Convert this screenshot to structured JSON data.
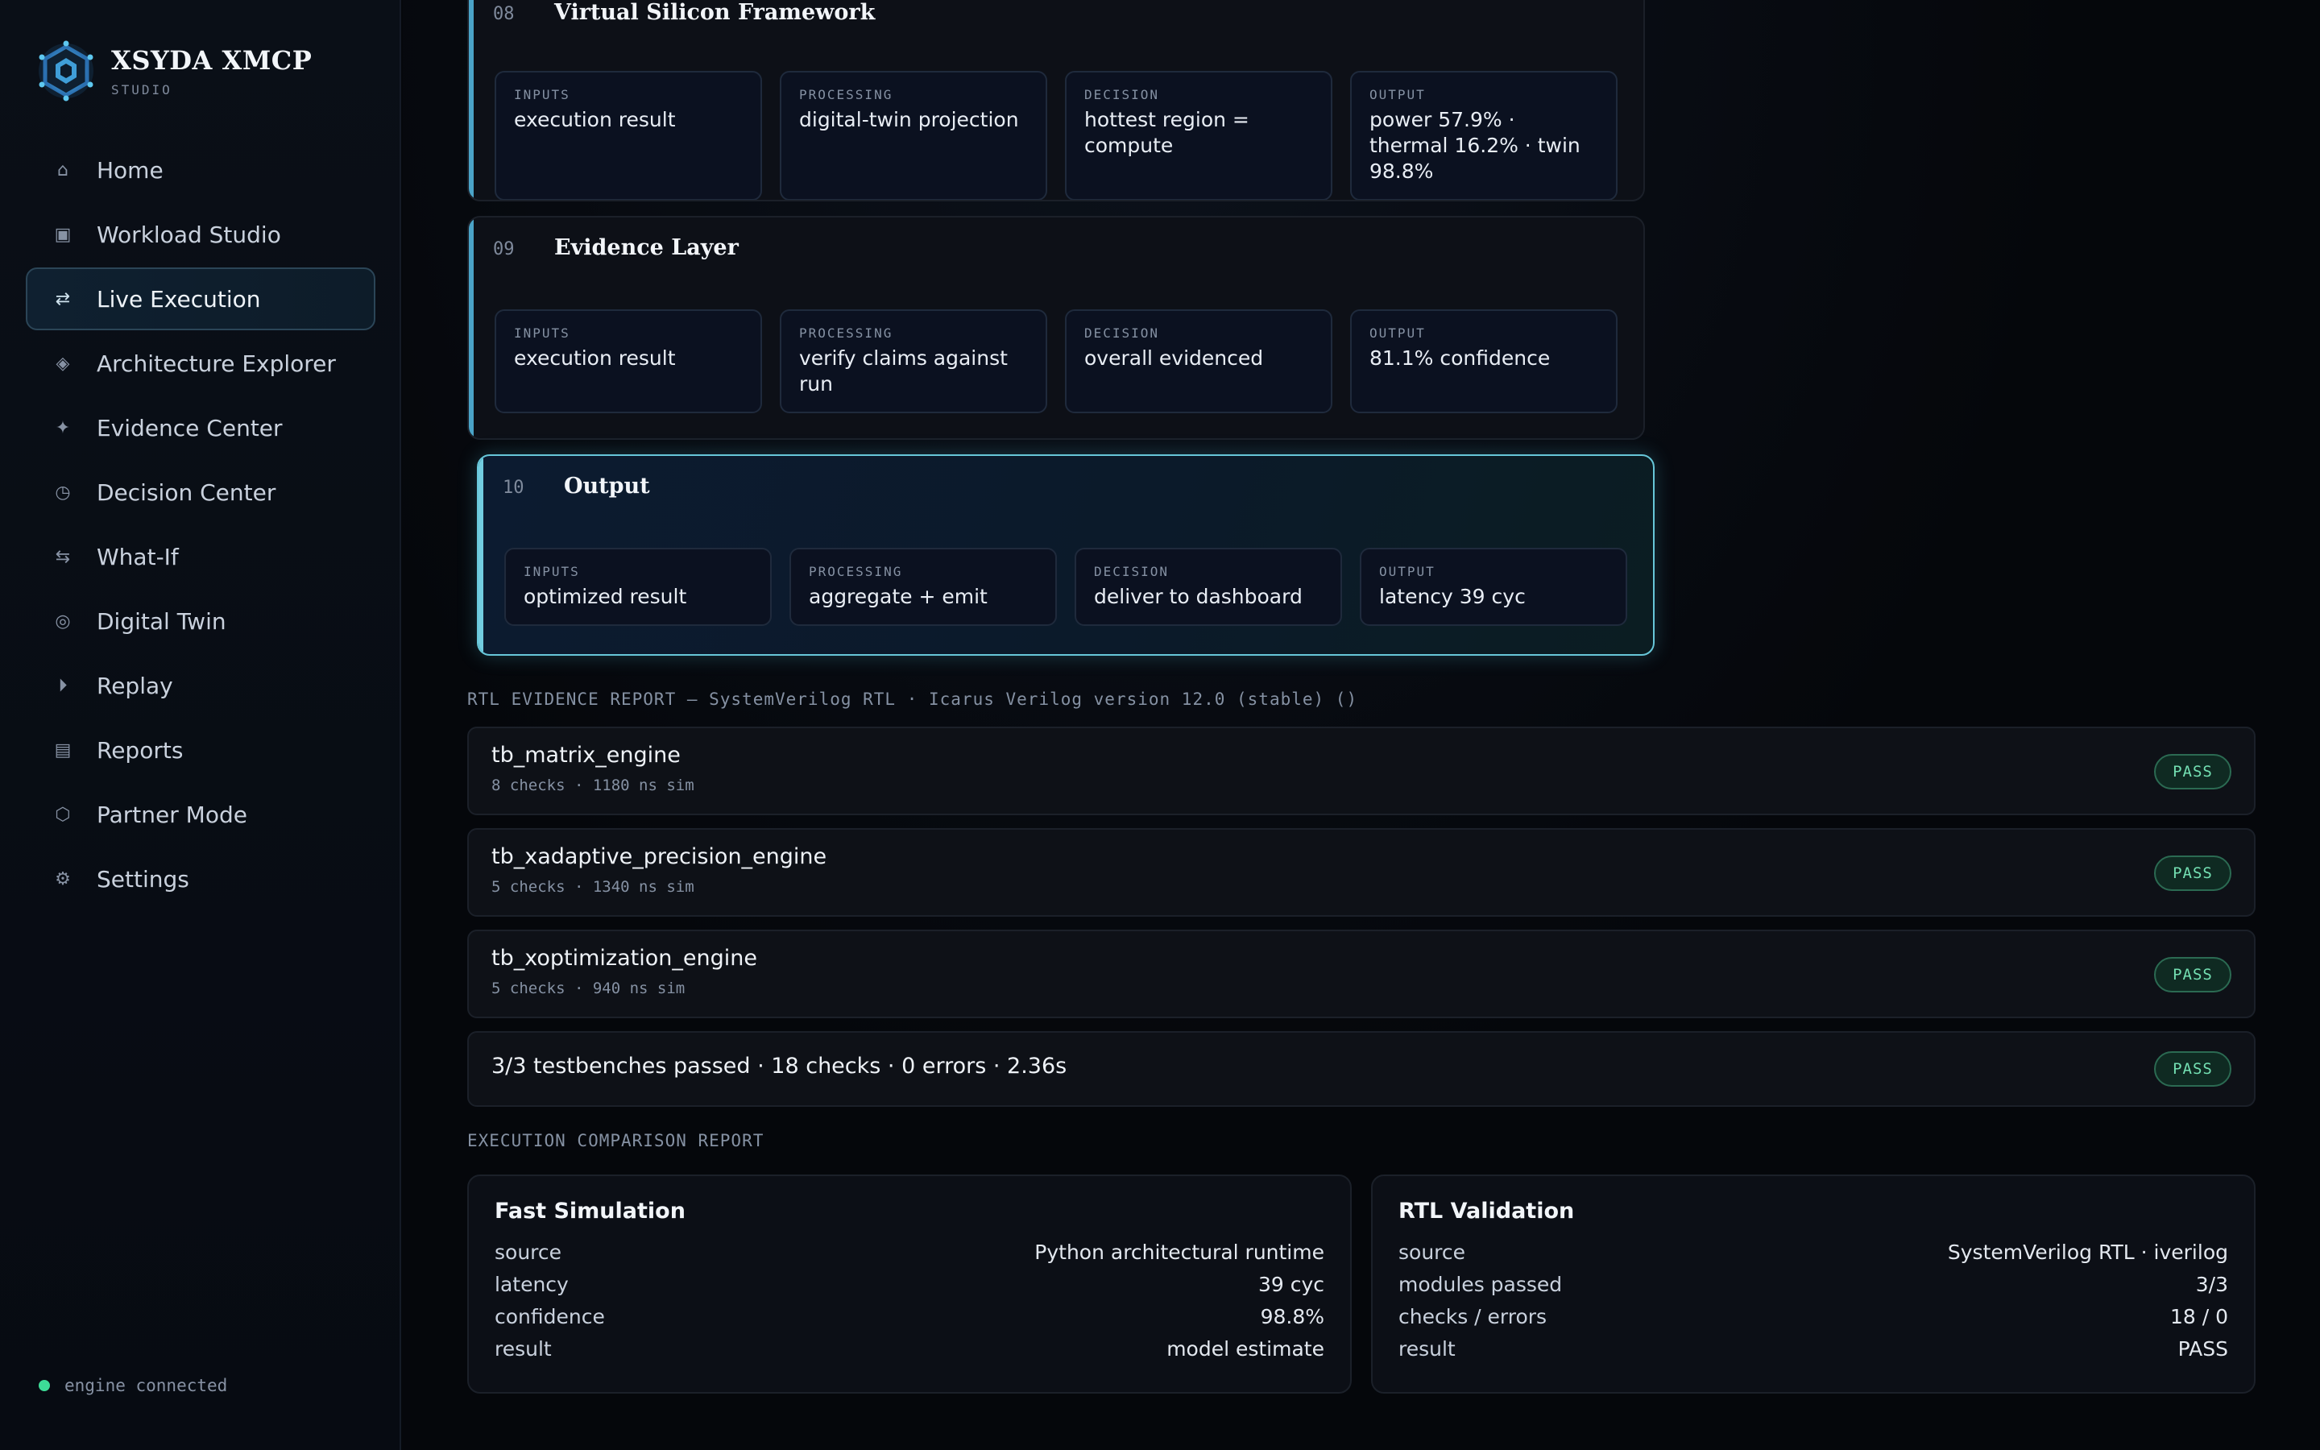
{
  "brand": {
    "name": "XSYDA XMCP",
    "sub": "STUDIO"
  },
  "nav": [
    {
      "label": "Home",
      "icon": "⌂",
      "icon_name": "home-icon",
      "active": false
    },
    {
      "label": "Workload Studio",
      "icon": "▣",
      "icon_name": "workload-icon",
      "active": false
    },
    {
      "label": "Live Execution",
      "icon": "⇄",
      "icon_name": "live-execution-icon",
      "active": true
    },
    {
      "label": "Architecture Explorer",
      "icon": "◈",
      "icon_name": "architecture-icon",
      "active": false
    },
    {
      "label": "Evidence Center",
      "icon": "✦",
      "icon_name": "evidence-icon",
      "active": false
    },
    {
      "label": "Decision Center",
      "icon": "◷",
      "icon_name": "decision-icon",
      "active": false
    },
    {
      "label": "What-If",
      "icon": "⇆",
      "icon_name": "what-if-icon",
      "active": false
    },
    {
      "label": "Digital Twin",
      "icon": "◎",
      "icon_name": "digital-twin-icon",
      "active": false
    },
    {
      "label": "Replay",
      "icon": "⏵",
      "icon_name": "replay-icon",
      "active": false
    },
    {
      "label": "Reports",
      "icon": "▤",
      "icon_name": "reports-icon",
      "active": false
    },
    {
      "label": "Partner Mode",
      "icon": "⬡",
      "icon_name": "partner-icon",
      "active": false
    },
    {
      "label": "Settings",
      "icon": "⚙",
      "icon_name": "settings-icon",
      "active": false
    }
  ],
  "status": {
    "text": "engine connected",
    "color": "#3ddc97"
  },
  "stages": [
    {
      "num": "08",
      "title": "Virtual Silicon Framework",
      "cells": [
        {
          "label": "INPUTS",
          "value": "execution result"
        },
        {
          "label": "PROCESSING",
          "value": "digital-twin projection"
        },
        {
          "label": "DECISION",
          "value": "hottest region = compute"
        },
        {
          "label": "OUTPUT",
          "value": "power 57.9% · thermal 16.2% · twin 98.8%"
        }
      ]
    },
    {
      "num": "09",
      "title": "Evidence Layer",
      "cells": [
        {
          "label": "INPUTS",
          "value": "execution result"
        },
        {
          "label": "PROCESSING",
          "value": "verify claims against run"
        },
        {
          "label": "DECISION",
          "value": "overall evidenced"
        },
        {
          "label": "OUTPUT",
          "value": "81.1% confidence"
        }
      ]
    },
    {
      "num": "10",
      "title": "Output",
      "cells": [
        {
          "label": "INPUTS",
          "value": "optimized result"
        },
        {
          "label": "PROCESSING",
          "value": "aggregate + emit"
        },
        {
          "label": "DECISION",
          "value": "deliver to dashboard"
        },
        {
          "label": "OUTPUT",
          "value": "latency 39 cyc"
        }
      ]
    }
  ],
  "rtl": {
    "heading": "RTL EVIDENCE REPORT — SystemVerilog RTL · Icarus Verilog version 12.0 (stable) ()",
    "rows": [
      {
        "name": "tb_matrix_engine",
        "meta": "8 checks · 1180 ns sim",
        "status": "PASS"
      },
      {
        "name": "tb_xadaptive_precision_engine",
        "meta": "5 checks · 1340 ns sim",
        "status": "PASS"
      },
      {
        "name": "tb_xoptimization_engine",
        "meta": "5 checks · 940 ns sim",
        "status": "PASS"
      }
    ],
    "summary": {
      "text": "3/3 testbenches passed · 18 checks · 0 errors · 2.36s",
      "status": "PASS"
    }
  },
  "comparison": {
    "heading": "EXECUTION COMPARISON REPORT",
    "cards": [
      {
        "title": "Fast Simulation",
        "rows": [
          {
            "k": "source",
            "v": "Python architectural runtime"
          },
          {
            "k": "latency",
            "v": "39 cyc"
          },
          {
            "k": "confidence",
            "v": "98.8%"
          },
          {
            "k": "result",
            "v": "model estimate"
          }
        ]
      },
      {
        "title": "RTL Validation",
        "rows": [
          {
            "k": "source",
            "v": "SystemVerilog RTL · iverilog"
          },
          {
            "k": "modules passed",
            "v": "3/3"
          },
          {
            "k": "checks / errors",
            "v": "18 / 0"
          },
          {
            "k": "result",
            "v": "PASS"
          }
        ]
      }
    ]
  },
  "colors": {
    "accent": "#4aa3c7",
    "highlight": "#67c7d9",
    "pass": "#74e0b3"
  }
}
